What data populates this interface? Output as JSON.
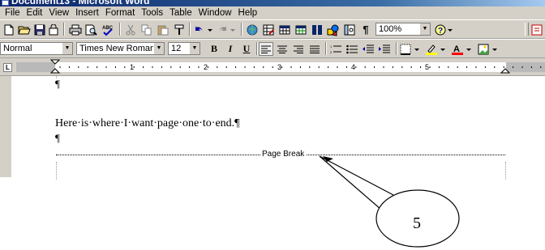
{
  "window": {
    "title": "Document13 - Microsoft Word"
  },
  "menu": [
    "File",
    "Edit",
    "View",
    "Insert",
    "Format",
    "Tools",
    "Table",
    "Window",
    "Help"
  ],
  "toolbar_standard": {
    "zoom": "100%",
    "icons": [
      "new-icon",
      "open-icon",
      "save-icon",
      "permission-icon",
      "print-icon",
      "print-preview-icon",
      "spelling-icon",
      "cut-icon",
      "copy-icon",
      "paste-icon",
      "format-painter-icon",
      "undo-icon",
      "redo-icon",
      "hyperlink-icon",
      "tables-borders-icon",
      "insert-table-icon",
      "insert-excel-icon",
      "columns-icon",
      "drawing-icon",
      "document-map-icon",
      "show-formatting-icon",
      "help-icon"
    ],
    "show_formatting_glyph": "¶"
  },
  "toolbar_formatting": {
    "style": "Normal",
    "font": "Times New Roman",
    "size": "12",
    "bold": "B",
    "italic": "I",
    "underline": "U",
    "font_color_glyph": "A"
  },
  "ruler": {
    "numbers": [
      "1",
      "2",
      "3",
      "4",
      "5"
    ],
    "tab_selector": "L"
  },
  "document": {
    "para_mark_1": "¶",
    "line": "Here·is·where·I·want·page·one·to·end.¶",
    "para_mark_2": "¶",
    "page_break": "Page Break"
  },
  "callout": {
    "label": "5"
  },
  "colors": {
    "chrome": "#d4d0c8",
    "title_bar": "#0a246a",
    "highlight_yellow": "#ffff00",
    "font_red": "#ff0000"
  }
}
